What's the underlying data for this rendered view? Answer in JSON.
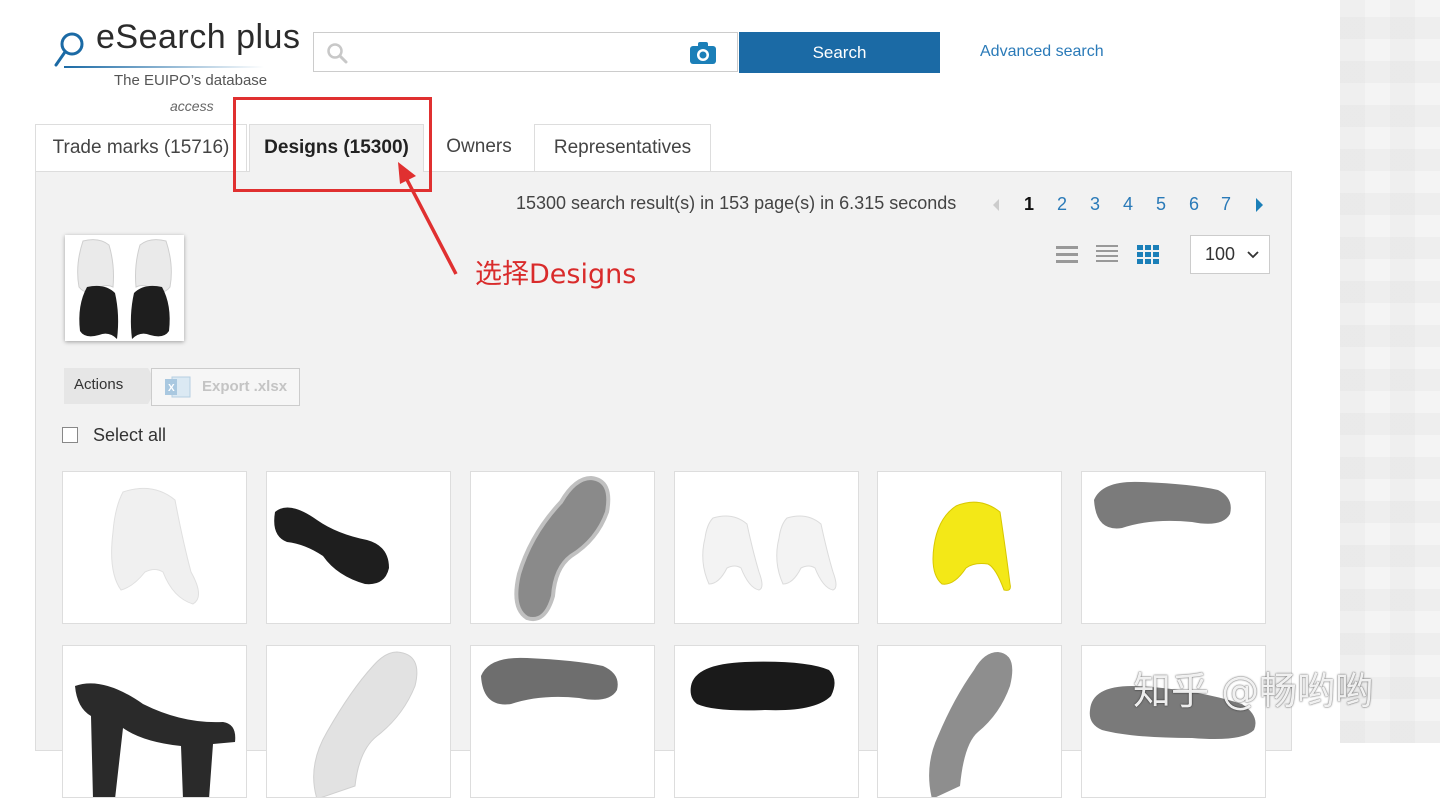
{
  "logo": {
    "title": "eSearch plus",
    "subtitle": "The EUIPO’s database",
    "subtitle_2": "access"
  },
  "search": {
    "placeholder": "",
    "value": "",
    "button_label": "Search",
    "advanced_link": "Advanced search"
  },
  "tabs": [
    {
      "label": "Trade marks (15716)",
      "active": false
    },
    {
      "label": "Designs (15300)",
      "active": true
    },
    {
      "label": "Owners",
      "active": false
    },
    {
      "label": "Representatives",
      "active": false
    }
  ],
  "annotation": {
    "text": "选择Designs",
    "color": "#d92b2b"
  },
  "results": {
    "summary": "15300 search result(s) in 153 page(s) in 6.315 seconds",
    "pages": [
      "1",
      "2",
      "3",
      "4",
      "5",
      "6",
      "7"
    ],
    "current_page": "1",
    "per_page": "100"
  },
  "actions": {
    "label": "Actions",
    "export_label": "Export .xlsx"
  },
  "select_all_label": "Select all",
  "colors": {
    "accent": "#1b6aa5",
    "link": "#2a7ab8",
    "highlight": "#e03030"
  },
  "watermark": "知乎 @畅哟哟"
}
